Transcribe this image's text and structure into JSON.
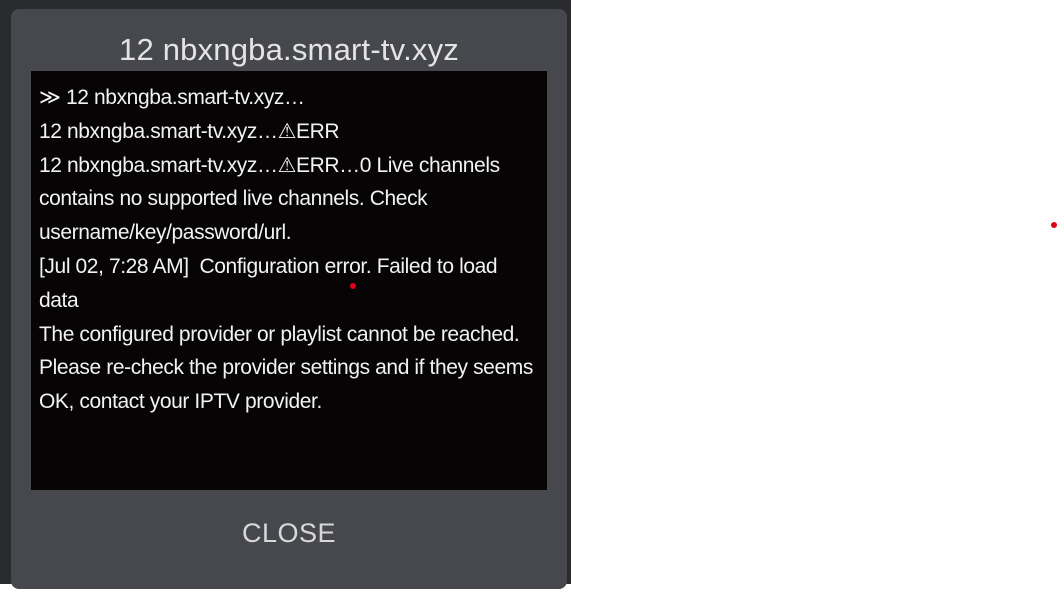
{
  "dialog": {
    "title": "12 nbxngba.smart-tv.xyz",
    "log_lines": [
      "≫ 12 nbxngba.smart-tv.xyz…",
      "12 nbxngba.smart-tv.xyz…⚠ERR",
      "12 nbxngba.smart-tv.xyz…⚠ERR…0 Live channels",
      "contains no supported live channels. Check username/key/password/url.",
      "[Jul 02, 7:28 AM]  Configuration error. Failed to load data",
      "The configured provider or playlist cannot be reached. Please re-check the provider settings and if they seems OK, contact your IPTV provider."
    ],
    "close_label": "CLOSE"
  },
  "colors": {
    "backdrop": "#2a2b2e",
    "dialog_bg": "#46484d",
    "log_bg": "#060404",
    "text": "#f2f2f2",
    "marker": "#e0001b"
  }
}
